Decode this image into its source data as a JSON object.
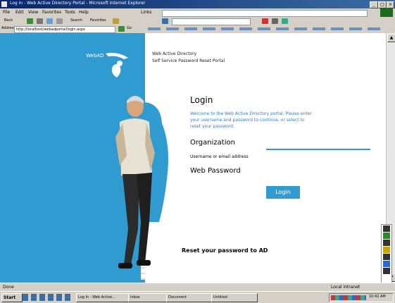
{
  "window": {
    "title": "Log In - Web Active Directory Portal - Microsoft Internet Explorer",
    "minimize_glyph": "_",
    "maximize_glyph": "□",
    "close_glyph": "×"
  },
  "menubar": {
    "items": [
      "File",
      "Edit",
      "View",
      "Favorites",
      "Tools",
      "Help"
    ],
    "links_label": "Links"
  },
  "toolbar": {
    "back_label": "Back",
    "search_label": "Search",
    "favorites_label": "Favorites"
  },
  "addressbar": {
    "label": "Address",
    "url": "http://localhost/webadportal/login.aspx",
    "go_label": "Go"
  },
  "page": {
    "logo_text": "WebAD",
    "top_line_1": "Web Active Directory",
    "top_line_2": "Self Service Password Reset Portal",
    "login_title": "Login",
    "login_description": "Welcome to the Web Active Directory portal. Please enter your username and password to continue, or select to reset your password.",
    "org_label": "Organization",
    "username_label": "Username or email address",
    "password_label": "Web Password",
    "login_button": "Login",
    "footer": "Reset your password to AD"
  },
  "statusbar": {
    "status": "Done",
    "zone": "Local intranet"
  },
  "taskbar": {
    "start_label": "Start",
    "buttons": [
      "Log In - Web Active...",
      "Inbox",
      "Document",
      "Untitled"
    ],
    "clock": "10:42 AM"
  },
  "colors": {
    "accent": "#2f9bd1",
    "link": "#2f7fc8",
    "titlebar": "#0a246a"
  }
}
